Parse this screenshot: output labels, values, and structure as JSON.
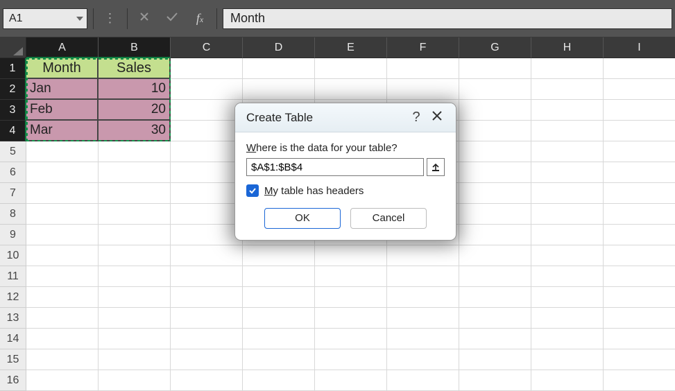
{
  "topbar": {
    "namebox_value": "A1",
    "formula_value": "Month"
  },
  "columns": [
    "A",
    "B",
    "C",
    "D",
    "E",
    "F",
    "G",
    "H",
    "I"
  ],
  "row_numbers": [
    "1",
    "2",
    "3",
    "4",
    "5",
    "6",
    "7",
    "8",
    "9",
    "10",
    "11",
    "12",
    "13",
    "14",
    "15",
    "16"
  ],
  "selected_cols": [
    "A",
    "B"
  ],
  "selected_rows": [
    "1",
    "2",
    "3",
    "4"
  ],
  "table": {
    "headers": [
      "Month",
      "Sales"
    ],
    "rows": [
      {
        "month": "Jan",
        "sales": "10"
      },
      {
        "month": "Feb",
        "sales": "20"
      },
      {
        "month": "Mar",
        "sales": "30"
      }
    ]
  },
  "dialog": {
    "title": "Create Table",
    "prompt_prefix": "W",
    "prompt_rest": "here is the data for your table?",
    "range_value": "$A$1:$B$4",
    "checkbox_prefix": "M",
    "checkbox_rest": "y table has headers",
    "checkbox_checked": true,
    "ok_label": "OK",
    "cancel_label": "Cancel"
  },
  "chart_data": {
    "type": "table",
    "title": "",
    "columns": [
      "Month",
      "Sales"
    ],
    "rows": [
      [
        "Jan",
        10
      ],
      [
        "Feb",
        20
      ],
      [
        "Mar",
        30
      ]
    ]
  }
}
